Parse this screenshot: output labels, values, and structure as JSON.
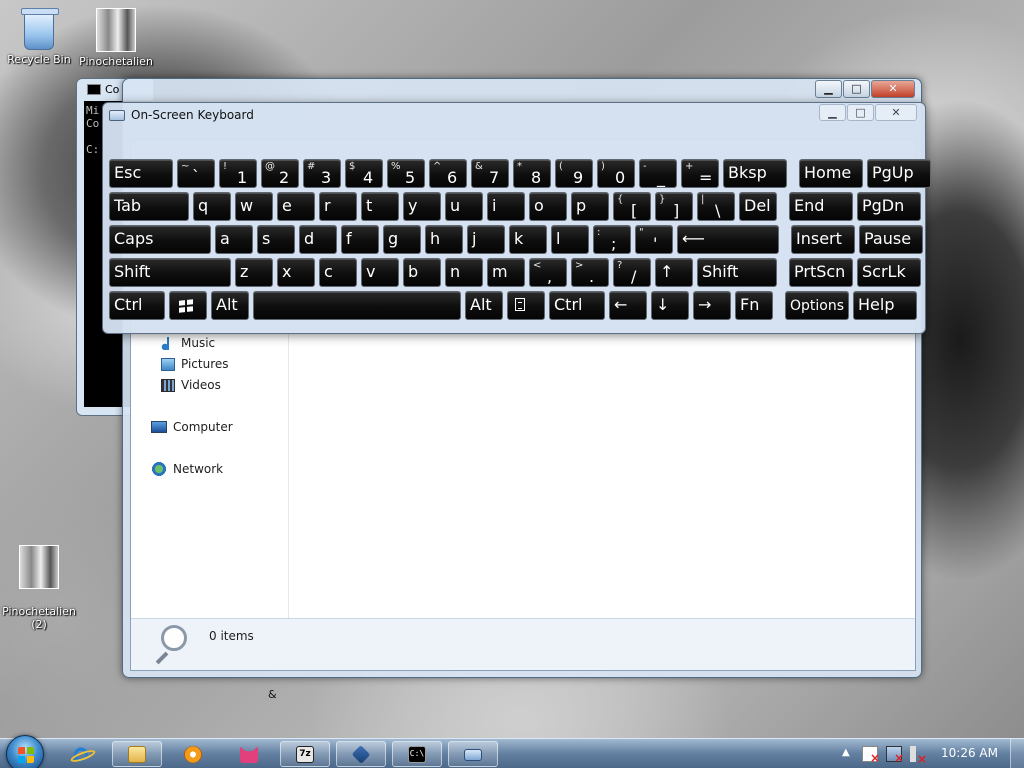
{
  "desktop": {
    "icons": [
      {
        "label": "Recycle Bin"
      },
      {
        "label": "Pinochetalien"
      },
      {
        "label": "Pinochetalien\n(2)"
      }
    ]
  },
  "cmd_window": {
    "title": "Co",
    "lines": "Mi\nCo\n\nC:"
  },
  "explorer": {
    "nav": {
      "music": "Music",
      "pictures": "Pictures",
      "videos": "Videos",
      "computer": "Computer",
      "network": "Network"
    },
    "items_count": "0 items"
  },
  "stray_text": "&",
  "osk": {
    "title": "On-Screen Keyboard",
    "rows": [
      [
        {
          "id": "esc",
          "main": "Esc",
          "w": 64
        },
        {
          "id": "tilde",
          "sub": "~",
          "main": "`",
          "w": 38
        },
        {
          "id": "1",
          "sub": "!",
          "low": "1",
          "w": 38
        },
        {
          "id": "2",
          "sub": "@",
          "low": "2",
          "w": 38
        },
        {
          "id": "3",
          "sub": "#",
          "low": "3",
          "w": 38
        },
        {
          "id": "4",
          "sub": "$",
          "low": "4",
          "w": 38
        },
        {
          "id": "5",
          "sub": "%",
          "low": "5",
          "w": 38
        },
        {
          "id": "6",
          "sub": "^",
          "low": "6",
          "w": 38
        },
        {
          "id": "7",
          "sub": "&",
          "low": "7",
          "w": 38
        },
        {
          "id": "8",
          "sub": "*",
          "low": "8",
          "w": 38
        },
        {
          "id": "9",
          "sub": "(",
          "low": "9",
          "w": 38
        },
        {
          "id": "0",
          "sub": ")",
          "low": "0",
          "w": 38
        },
        {
          "id": "minus",
          "sub": "-",
          "low": "_",
          "w": 38
        },
        {
          "id": "equals",
          "sub": "+",
          "low": "=",
          "w": 38
        },
        {
          "id": "bksp",
          "main": "Bksp",
          "w": 64
        },
        {
          "id": "home",
          "main": "Home",
          "w": 64,
          "gap": 8
        },
        {
          "id": "pgup",
          "main": "PgUp",
          "w": 64
        }
      ],
      [
        {
          "id": "tab",
          "main": "Tab",
          "w": 80
        },
        {
          "id": "q",
          "main": "q",
          "w": 38
        },
        {
          "id": "w",
          "main": "w",
          "w": 38
        },
        {
          "id": "e",
          "main": "e",
          "w": 38
        },
        {
          "id": "r",
          "main": "r",
          "w": 38
        },
        {
          "id": "t",
          "main": "t",
          "w": 38
        },
        {
          "id": "y",
          "main": "y",
          "w": 38
        },
        {
          "id": "u",
          "main": "u",
          "w": 38
        },
        {
          "id": "i",
          "main": "i",
          "w": 38
        },
        {
          "id": "o",
          "main": "o",
          "w": 38
        },
        {
          "id": "p",
          "main": "p",
          "w": 38
        },
        {
          "id": "lbracket",
          "sub": "{",
          "low": "[",
          "w": 38
        },
        {
          "id": "rbracket",
          "sub": "}",
          "low": "]",
          "w": 38
        },
        {
          "id": "backslash",
          "sub": "|",
          "low": "\\",
          "w": 38
        },
        {
          "id": "del",
          "main": "Del",
          "w": 38
        },
        {
          "id": "end",
          "main": "End",
          "w": 64,
          "gap": 8
        },
        {
          "id": "pgdn",
          "main": "PgDn",
          "w": 64
        }
      ],
      [
        {
          "id": "caps",
          "main": "Caps",
          "w": 102
        },
        {
          "id": "a",
          "main": "a",
          "w": 38
        },
        {
          "id": "s",
          "main": "s",
          "w": 38
        },
        {
          "id": "d",
          "main": "d",
          "w": 38
        },
        {
          "id": "f",
          "main": "f",
          "w": 38
        },
        {
          "id": "g",
          "main": "g",
          "w": 38
        },
        {
          "id": "h",
          "main": "h",
          "w": 38
        },
        {
          "id": "j",
          "main": "j",
          "w": 38
        },
        {
          "id": "k",
          "main": "k",
          "w": 38
        },
        {
          "id": "l",
          "main": "l",
          "w": 38
        },
        {
          "id": "semicolon",
          "sub": ":",
          "low": ";",
          "w": 38
        },
        {
          "id": "quote",
          "sub": "\"",
          "low": "'",
          "w": 38
        },
        {
          "id": "enter",
          "main": "⟵",
          "w": 102
        },
        {
          "id": "insert",
          "main": "Insert",
          "w": 64,
          "gap": 8
        },
        {
          "id": "pause",
          "main": "Pause",
          "w": 64
        }
      ],
      [
        {
          "id": "lshift",
          "main": "Shift",
          "w": 122
        },
        {
          "id": "z",
          "main": "z",
          "w": 38
        },
        {
          "id": "x",
          "main": "x",
          "w": 38
        },
        {
          "id": "c",
          "main": "c",
          "w": 38
        },
        {
          "id": "v",
          "main": "v",
          "w": 38
        },
        {
          "id": "b",
          "main": "b",
          "w": 38
        },
        {
          "id": "n",
          "main": "n",
          "w": 38
        },
        {
          "id": "m",
          "main": "m",
          "w": 38
        },
        {
          "id": "comma",
          "sub": "<",
          "low": ",",
          "w": 38
        },
        {
          "id": "period",
          "sub": ">",
          "low": ".",
          "w": 38
        },
        {
          "id": "slash",
          "sub": "?",
          "low": "/",
          "w": 38
        },
        {
          "id": "up",
          "main": "↑",
          "w": 38
        },
        {
          "id": "rshift",
          "main": "Shift",
          "w": 80
        },
        {
          "id": "prtscn",
          "main": "PrtScn",
          "w": 64,
          "gap": 8
        },
        {
          "id": "scrlk",
          "main": "ScrLk",
          "w": 64
        }
      ],
      [
        {
          "id": "lctrl",
          "main": "Ctrl",
          "w": 56
        },
        {
          "id": "win",
          "glyph": "win",
          "w": 38
        },
        {
          "id": "lalt",
          "main": "Alt",
          "w": 38
        },
        {
          "id": "space",
          "main": "",
          "w": 208
        },
        {
          "id": "ralt",
          "main": "Alt",
          "w": 38
        },
        {
          "id": "menu",
          "glyph": "menu",
          "w": 38
        },
        {
          "id": "rctrl",
          "main": "Ctrl",
          "w": 56
        },
        {
          "id": "left",
          "main": "←",
          "w": 38
        },
        {
          "id": "down",
          "main": "↓",
          "w": 38
        },
        {
          "id": "right",
          "main": "→",
          "w": 38
        },
        {
          "id": "fn",
          "main": "Fn",
          "w": 38
        },
        {
          "id": "options",
          "main": "Options",
          "w": 64,
          "gap": 8,
          "small": true
        },
        {
          "id": "help",
          "main": "Help",
          "w": 64
        }
      ]
    ]
  },
  "taskbar": {
    "buttons": [
      {
        "id": "ie",
        "glyph": "g-ie",
        "open": false
      },
      {
        "id": "explorer",
        "glyph": "g-folder",
        "open": true
      },
      {
        "id": "media",
        "glyph": "g-media",
        "open": false
      },
      {
        "id": "cat",
        "glyph": "g-cat",
        "open": false
      },
      {
        "id": "7zip",
        "glyph": "g-7z",
        "label": "7z",
        "open": true
      },
      {
        "id": "virtualbox",
        "glyph": "g-box",
        "open": true
      },
      {
        "id": "cmd",
        "glyph": "g-cmd",
        "label": "C:\\",
        "open": true
      },
      {
        "id": "osk",
        "glyph": "g-kbd",
        "open": true
      }
    ],
    "clock": "10:26 AM"
  }
}
